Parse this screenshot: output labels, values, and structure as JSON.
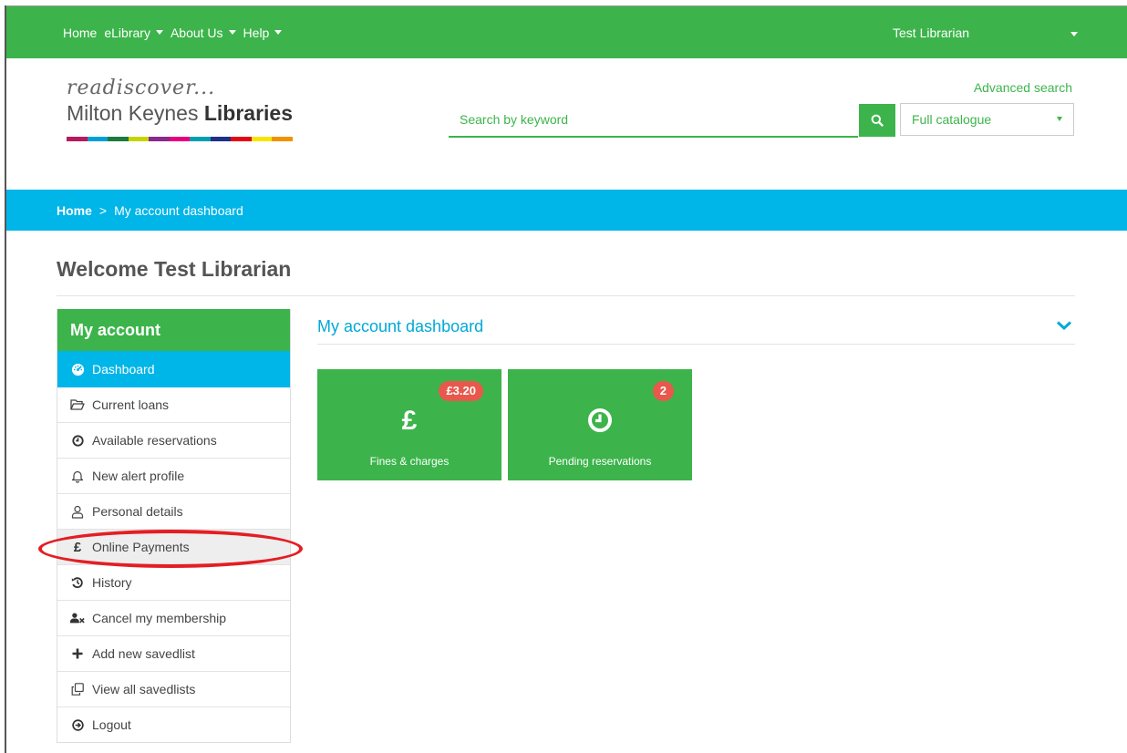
{
  "topnav": {
    "items": [
      {
        "label": "Home",
        "has_caret": false
      },
      {
        "label": "eLibrary",
        "has_caret": true
      },
      {
        "label": "About Us",
        "has_caret": true
      },
      {
        "label": "Help",
        "has_caret": true
      }
    ],
    "user": "Test Librarian",
    "color": "#3cb44b"
  },
  "logo": {
    "tagline": "readiscover...",
    "name_regular": "Milton Keynes ",
    "name_bold": "Libraries",
    "stripe_colors": [
      "#b5195f",
      "#00a0d6",
      "#1d7b3c",
      "#c8d400",
      "#8b2a8b",
      "#e6007e",
      "#00a0b0",
      "#1f2f8a",
      "#e30613",
      "#f9e300",
      "#f39200"
    ]
  },
  "search": {
    "placeholder": "Search by keyword",
    "scope_selected": "Full catalogue",
    "advanced_label": "Advanced search"
  },
  "breadcrumb": {
    "home": "Home",
    "separator": ">",
    "current": "My account dashboard"
  },
  "welcome": "Welcome Test Librarian",
  "sidebar": {
    "title": "My account",
    "items": [
      {
        "label": "Dashboard",
        "icon": "dashboard-icon",
        "active": true
      },
      {
        "label": "Current loans",
        "icon": "folder-open-icon"
      },
      {
        "label": "Available reservations",
        "icon": "clock-icon"
      },
      {
        "label": "New alert profile",
        "icon": "bell-icon"
      },
      {
        "label": "Personal details",
        "icon": "user-icon"
      },
      {
        "label": "Online Payments",
        "icon": "pound-icon",
        "highlighted": true
      },
      {
        "label": "History",
        "icon": "history-icon"
      },
      {
        "label": "Cancel my membership",
        "icon": "user-times-icon"
      },
      {
        "label": "Add new savedlist",
        "icon": "plus-icon"
      },
      {
        "label": "View all savedlists",
        "icon": "clone-icon"
      },
      {
        "label": "Logout",
        "icon": "arrow-circle-icon"
      }
    ]
  },
  "dashboard": {
    "title": "My account dashboard",
    "tiles": [
      {
        "label": "Fines & charges",
        "badge": "£3.20",
        "icon": "pound-icon",
        "glyph": "£"
      },
      {
        "label": "Pending reservations",
        "badge": "2",
        "icon": "clock-icon"
      }
    ]
  },
  "colors": {
    "green": "#3cb44b",
    "blue": "#00b5e8",
    "badge_red": "#e8584c",
    "annotation_red": "#e31e24"
  }
}
